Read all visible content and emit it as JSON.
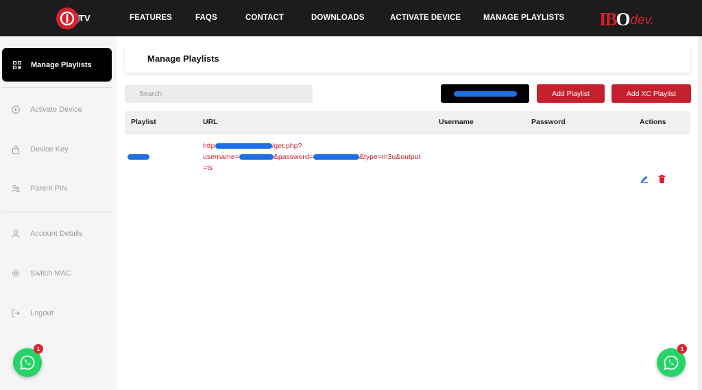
{
  "nav": {
    "items": [
      "FEATURES",
      "FAQS",
      "CONTACT",
      "DOWNLOADS",
      "ACTIVATE DEVICE",
      "MANAGE PLAYLISTS"
    ],
    "logo_text": "TV",
    "brand": {
      "part1": "IB",
      "part2": "O",
      "suffix": "dev."
    }
  },
  "sidebar": {
    "active": {
      "label": "Manage Playlists",
      "icon": "grid-icon"
    },
    "items": [
      {
        "label": "Activate Device",
        "icon": "play-circle-icon"
      },
      {
        "label": "Device Key",
        "icon": "lock-icon"
      },
      {
        "label": "Parent PIN",
        "icon": "users-icon"
      },
      {
        "label": "Account Details",
        "icon": "user-icon"
      },
      {
        "label": "Switch MAC",
        "icon": "gear-icon"
      },
      {
        "label": "Logout",
        "icon": "logout-icon"
      }
    ]
  },
  "main": {
    "title": "Manage Playlists",
    "search_placeholder": "Search",
    "buttons": {
      "add_playlist": "Add Playlist",
      "add_xc_playlist": "Add XC Playlist"
    },
    "table": {
      "columns": [
        "Playlist",
        "URL",
        "Username",
        "Password",
        "Actions"
      ],
      "rows": [
        {
          "url_parts": [
            "http",
            "/get.php?",
            "username=",
            "&password=",
            "&type=m3u&output",
            "=ts"
          ]
        }
      ]
    }
  },
  "whatsapp": {
    "badge": "1"
  },
  "colors": {
    "accent_red": "#c5202d",
    "redaction_blue": "#1e6fe3",
    "topbar": "#1c1c1c",
    "whatsapp_green": "#25d366"
  }
}
